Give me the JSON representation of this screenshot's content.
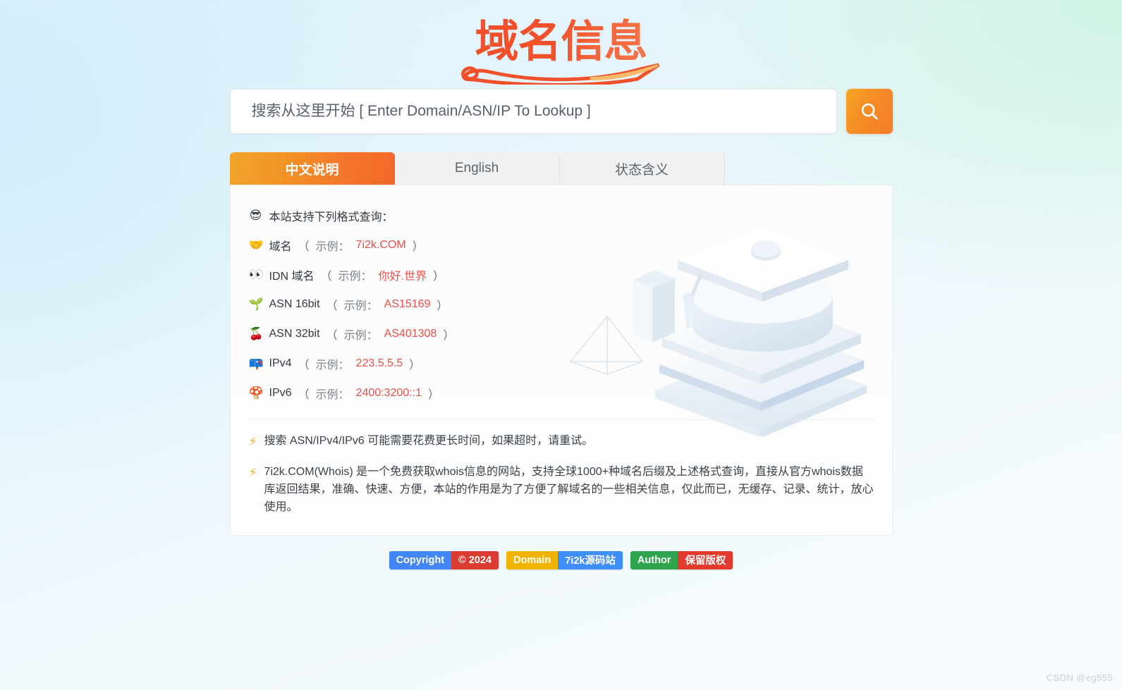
{
  "site": {
    "logo_text": "域名信息",
    "background_colors": {
      "top_left": "#ddf1fb",
      "top_right": "#cef4e2",
      "bottom": "#f6fbfe"
    }
  },
  "search": {
    "placeholder": "搜索从这里开始 [ Enter Domain/ASN/IP To Lookup ]",
    "value": "",
    "button_icon": "search-icon",
    "button_color": "#f58f26"
  },
  "tabs": [
    {
      "label": "中文说明",
      "active": true
    },
    {
      "label": "English",
      "active": false
    },
    {
      "label": "状态含义",
      "active": false
    }
  ],
  "panel": {
    "heading": {
      "icon": "sunglasses-face-emoji",
      "text": "本站支持下列格式查询："
    },
    "formats": [
      {
        "icon": "handshake-emoji",
        "label": "域名",
        "paren_open": "（",
        "shili": "示例：",
        "value": "7i2k.COM",
        "paren_close": "）"
      },
      {
        "icon": "eyes-emoji",
        "label": "IDN 域名",
        "paren_open": "（",
        "shili": "示例：",
        "value": "你好.世界",
        "paren_close": "）"
      },
      {
        "icon": "seedling-emoji",
        "label": "ASN 16bit",
        "paren_open": "（",
        "shili": "示例：",
        "value": "AS15169",
        "paren_close": "）"
      },
      {
        "icon": "cherries-emoji",
        "label": "ASN 32bit",
        "paren_open": "（",
        "shili": "示例：",
        "value": "AS401308",
        "paren_close": "）"
      },
      {
        "icon": "mailbox-emoji",
        "label": "IPv4",
        "paren_open": "（",
        "shili": "示例：",
        "value": "223.5.5.5",
        "paren_close": "）"
      },
      {
        "icon": "mushroom-emoji",
        "label": "IPv6",
        "paren_open": "（",
        "shili": "示例：",
        "value": "2400:3200::1",
        "paren_close": "）"
      }
    ],
    "notes": [
      {
        "icon": "lightning-bolt-icon",
        "text": "搜索 ASN/IPv4/IPv6 可能需要花费更长时间，如果超时，请重试。"
      },
      {
        "icon": "lightning-bolt-icon",
        "text": "7i2k.COM(Whois) 是一个免费获取whois信息的网站，支持全球1000+种域名后缀及上述格式查询，直接从官方whois数据库返回结果，准确、快速、方便，本站的作用是为了方便了解域名的一些相关信息，仅此而已，无缓存、记录、统计，放心使用。"
      }
    ],
    "illustration": "graduation-cap-3d-illustration"
  },
  "footer": {
    "badges": [
      {
        "left_label": "Copyright",
        "left_color": "#4285f4",
        "right_label": "© 2024",
        "right_color": "#db3b30"
      },
      {
        "left_label": "Domain",
        "left_color": "#f0b400",
        "right_label": "7i2k源码站",
        "right_color": "#3f8df6"
      },
      {
        "left_label": "Author",
        "left_color": "#2ea44f",
        "right_label": "保留版权",
        "right_color": "#e23b2e"
      }
    ]
  },
  "watermark": "CSDN @eg555"
}
